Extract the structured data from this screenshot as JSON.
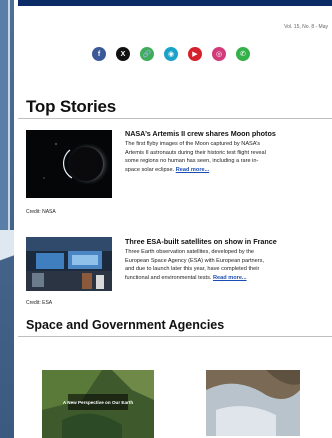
{
  "header": {
    "issue": "Vol. 15, No. 8 - May"
  },
  "social": [
    {
      "icon": "facebook-icon",
      "glyph": "f",
      "color": "#3b5998"
    },
    {
      "icon": "x-icon",
      "glyph": "X",
      "color": "#111111"
    },
    {
      "icon": "link-icon",
      "glyph": "🔗",
      "color": "#3fae5a"
    },
    {
      "icon": "flickr-icon",
      "glyph": "◉",
      "color": "#1aa3c8"
    },
    {
      "icon": "youtube-icon",
      "glyph": "▶",
      "color": "#d6202c"
    },
    {
      "icon": "instagram-icon",
      "glyph": "◎",
      "color": "#d33a7a"
    },
    {
      "icon": "whatsapp-icon",
      "glyph": "✆",
      "color": "#35b14a"
    }
  ],
  "top_stories": {
    "title": "Top Stories",
    "stories": [
      {
        "title": "NASA’s Artemis II crew shares Moon photos",
        "lines": [
          "The first flyby images of the Moon captured by NASA’s",
          "Artemis II astronauts during their historic test flight reveal",
          "some regions no human has seen, including a rare in-",
          "space solar eclipse."
        ],
        "more": "Read more...",
        "credit": "Credit: NASA"
      },
      {
        "title": "Three ESA-built satellites on show in France",
        "lines": [
          "Three Earth observation satellites, developed by the",
          "European Space Agency (ESA) with European partners,",
          "and due to launch later this year, have completed their",
          "functional and environmental tests."
        ],
        "more": "Read more...",
        "credit": "Credit: ESA"
      }
    ]
  },
  "agencies": {
    "title": "Space and Government Agencies",
    "thumb_caption": "A New Perspective on Our Earth"
  }
}
